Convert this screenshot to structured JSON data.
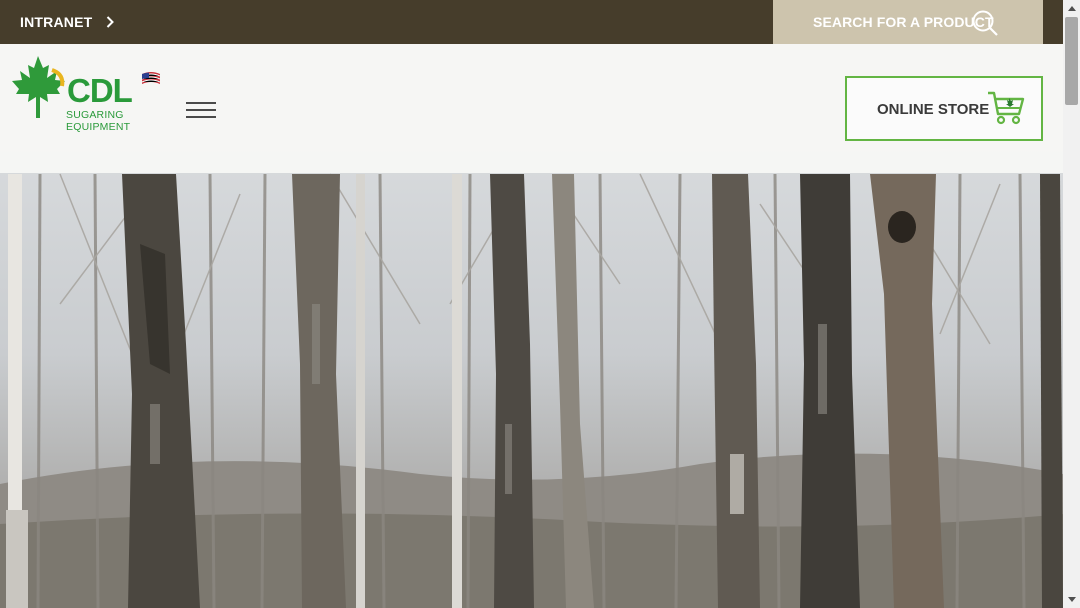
{
  "topbar": {
    "intranet_label": "INTRANET",
    "search_label": "SEARCH FOR A PRODUCT"
  },
  "header": {
    "logo": {
      "wordmark": "CDL",
      "subtitle_line1": "SUGARING",
      "subtitle_line2": "EQUIPMENT"
    },
    "store_label": "ONLINE STORE"
  },
  "hero": {
    "image": "winter-maple-forest-photo"
  },
  "colors": {
    "topbar_bg": "#463d2b",
    "search_bg": "#cdc4ad",
    "brand_green": "#2a9a3a",
    "store_border": "#63b543"
  },
  "icons": {
    "intranet": "chevron-right-icon",
    "search": "search-icon",
    "menu": "hamburger-menu-icon",
    "store": "shopping-cart-icon"
  }
}
